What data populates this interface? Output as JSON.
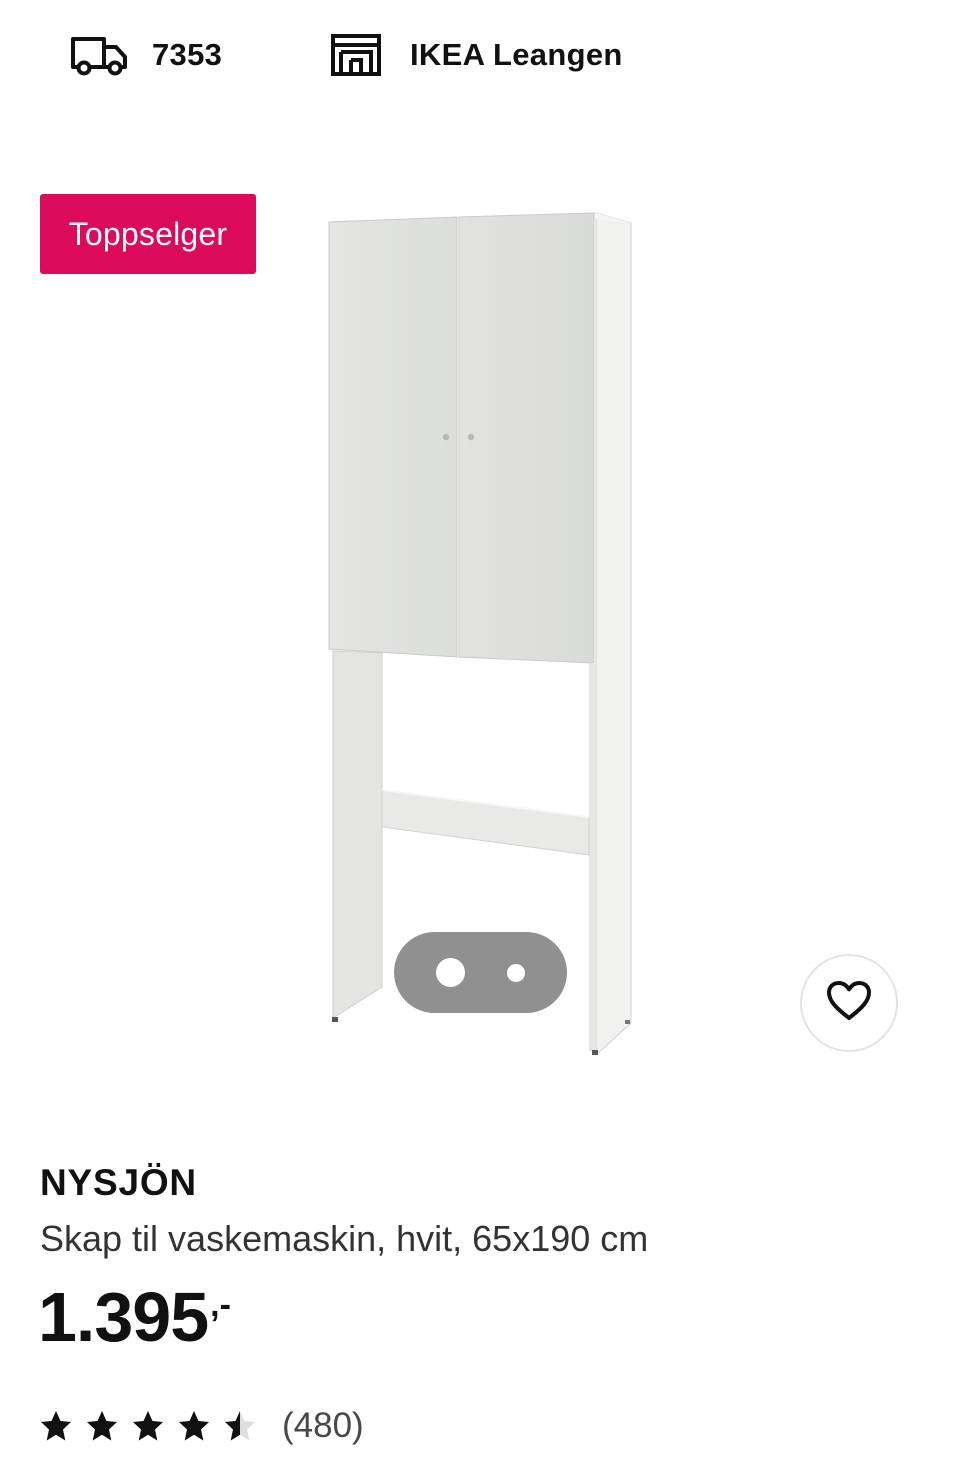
{
  "header": {
    "delivery": {
      "icon": "delivery-truck-icon",
      "postcode": "7353"
    },
    "store": {
      "icon": "store-icon",
      "name": "IKEA Leangen"
    }
  },
  "product": {
    "badge": "Toppselger",
    "badge_color": "#dc0a5a",
    "name": "NYSJÖN",
    "description": "Skap til vaskemaskin, hvit, 65x190 cm",
    "price": {
      "integer": "1.395",
      "suffix": ",-"
    },
    "rating": {
      "value": 4.5,
      "max": 5,
      "review_count": "(480)"
    },
    "image": {
      "alt": "NYSJÖN",
      "current_index": 1,
      "total": 2
    },
    "favourite_icon": "heart-outline-icon"
  }
}
